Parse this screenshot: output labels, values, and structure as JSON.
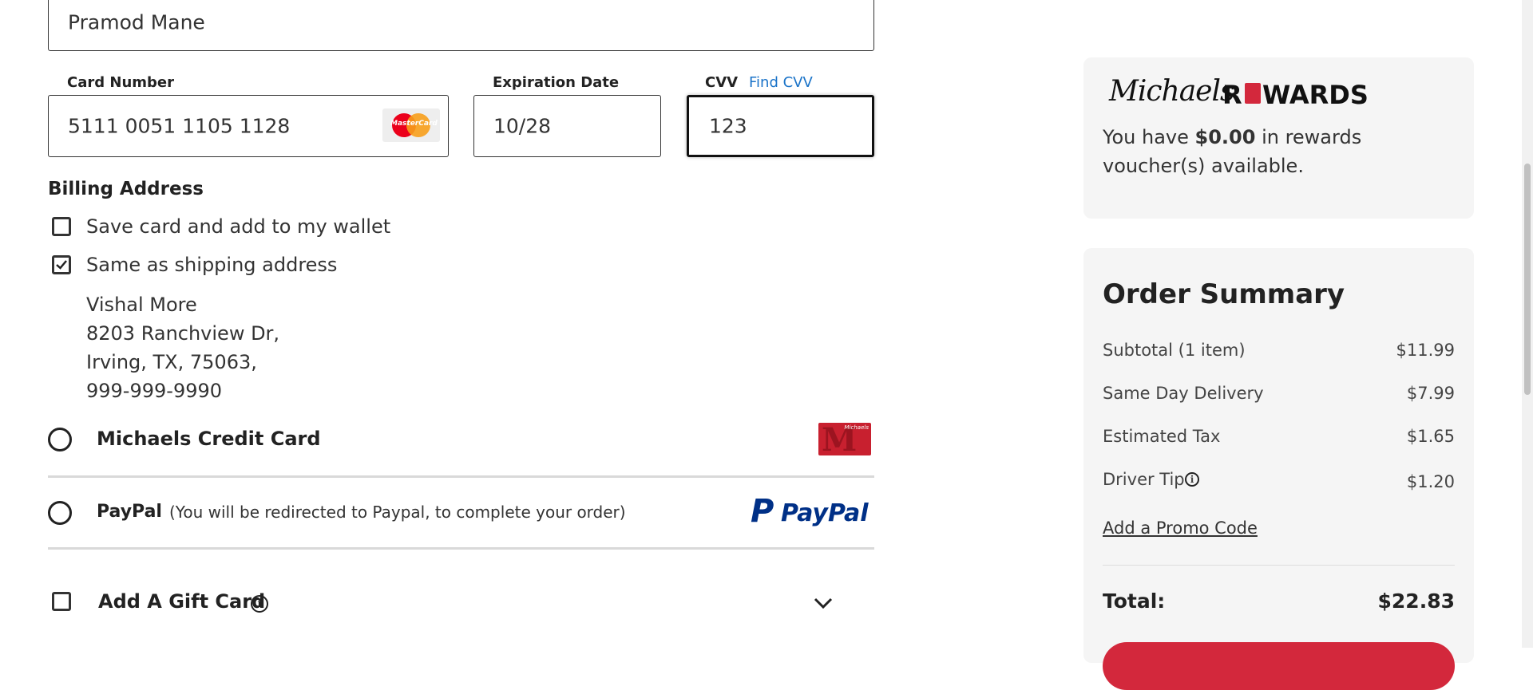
{
  "payment": {
    "name_on_card": "Pramod Mane",
    "card_number_label": "Card Number",
    "card_number": "5111 0051 1105 1128",
    "card_brand": "MasterCard",
    "expiration_label": "Expiration Date",
    "expiration": "10/28",
    "cvv_label": "CVV",
    "find_cvv": "Find CVV",
    "cvv": "123"
  },
  "billing": {
    "heading": "Billing Address",
    "save_card_label": "Save card and add to my wallet",
    "same_as_shipping_label": "Same as shipping address",
    "address_lines": [
      "Vishal More",
      "8203 Ranchview Dr,",
      "Irving, TX, 75063,",
      "999-999-9990"
    ]
  },
  "methods": {
    "michaels_credit": "Michaels Credit Card",
    "michaels_card_text": "Michaels",
    "paypal": "PayPal",
    "paypal_note": "(You will be redirected to Paypal, to complete your order)",
    "paypal_logo": "PayPal",
    "gift_card": "Add A Gift Card"
  },
  "rewards": {
    "logo_script": "Michaels",
    "logo_r": "R",
    "logo_rest": "WARDS",
    "text_prefix": "You have ",
    "amount": "$0.00",
    "text_suffix": " in rewards voucher(s) available."
  },
  "summary": {
    "title": "Order Summary",
    "rows": [
      {
        "label": "Subtotal (1 item)",
        "value": "$11.99"
      },
      {
        "label": "Same Day Delivery",
        "value": "$7.99"
      },
      {
        "label": "Estimated Tax",
        "value": "$1.65"
      },
      {
        "label": "Driver Tip",
        "value": "$1.20"
      }
    ],
    "promo_link": "Add a Promo Code",
    "total_label": "Total:",
    "total_value": "$22.83"
  },
  "colors": {
    "brand_red": "#d3283c",
    "link_blue": "#1a73c8",
    "paypal_dark": "#003087",
    "paypal_light": "#009cde"
  }
}
